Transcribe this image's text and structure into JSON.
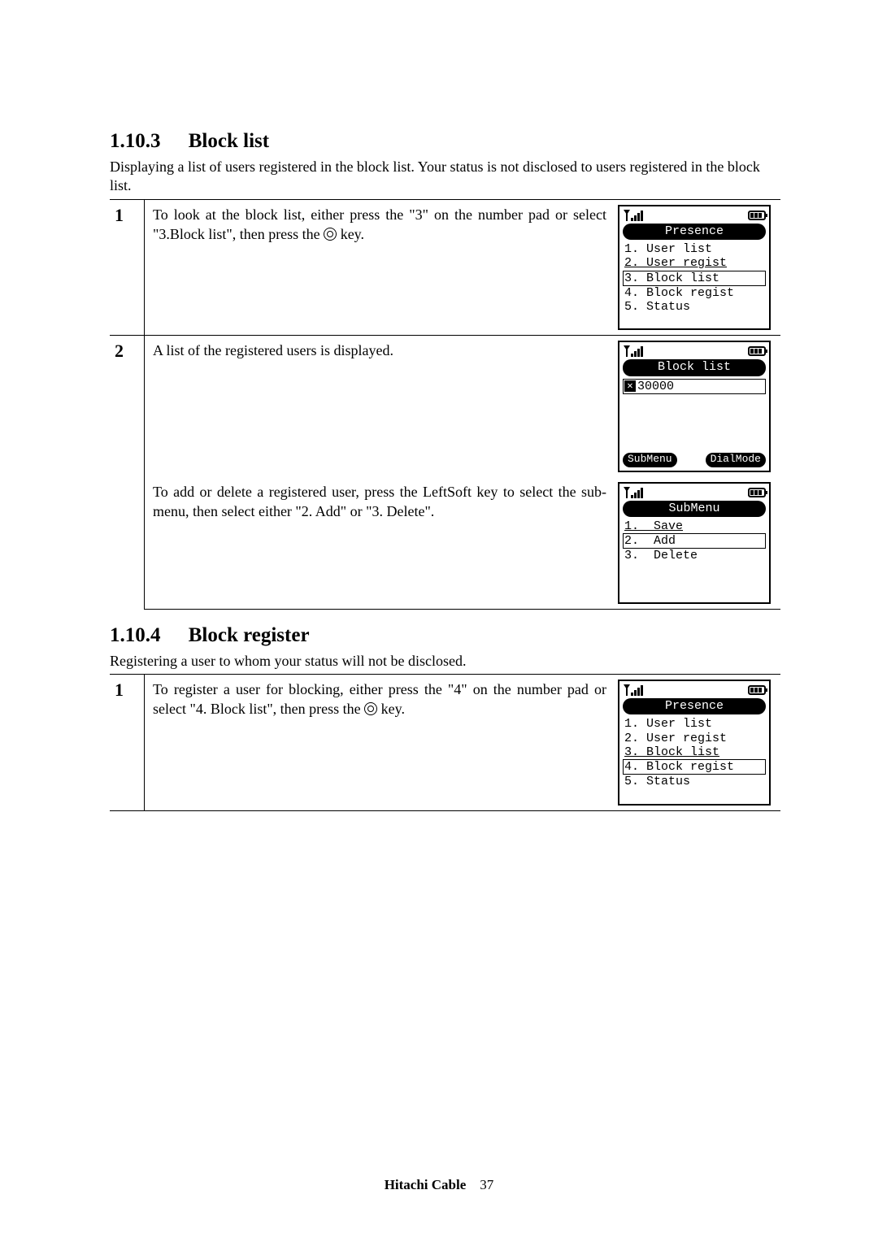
{
  "section1": {
    "number": "1.10.3",
    "title": "Block list",
    "intro": "Displaying a list of users registered in the block list. Your status is not disclosed to users registered in the block list.",
    "step1": {
      "num": "1",
      "text_a": "To look at the block list, either press the \"3\" on the number pad or select \"3.Block list\", then press the ",
      "text_b": " key.",
      "lcd_title": "Presence",
      "menu": [
        "1. User list",
        "2. User regist",
        "3. Block list",
        "4. Block regist",
        "5. Status"
      ]
    },
    "step2a": {
      "num": "2",
      "text": "A list of the registered users is displayed.",
      "lcd_title": "Block list",
      "entry": "30000",
      "soft_left": "SubMenu",
      "soft_right": "DialMode"
    },
    "step2b": {
      "text": "To add or delete a registered user, press the LeftSoft key to select the sub-menu, then select either \"2. Add\" or \"3. Delete\".",
      "lcd_title": "SubMenu",
      "menu": [
        "1.  Save",
        "2.  Add",
        "3.  Delete"
      ]
    }
  },
  "section2": {
    "number": "1.10.4",
    "title": "Block register",
    "intro": "Registering a user to whom your status will not be disclosed.",
    "step1": {
      "num": "1",
      "text_a": "To register a user for blocking, either press the \"4\" on the number pad or select \"4. Block list\", then press the ",
      "text_b": " key.",
      "lcd_title": "Presence",
      "menu": [
        "1. User list",
        "2. User regist",
        "3. Block list",
        "4. Block regist",
        "5. Status"
      ]
    }
  },
  "footer": {
    "brand": "Hitachi Cable",
    "page": "37"
  }
}
